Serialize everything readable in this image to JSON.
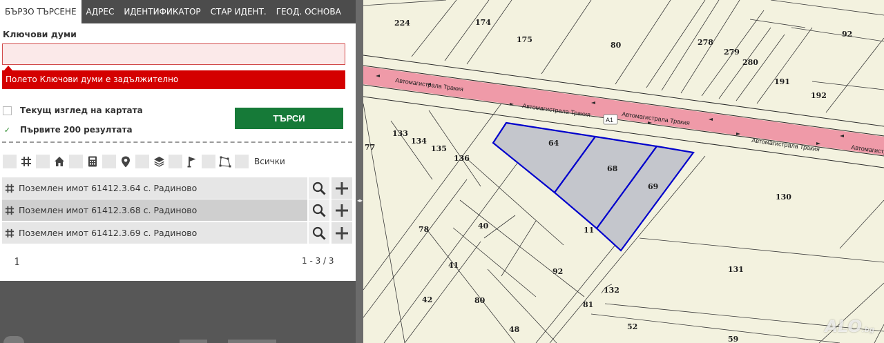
{
  "tabs": [
    {
      "label": "БЪРЗО ТЪРСЕНЕ",
      "active": true
    },
    {
      "label": "АДРЕС"
    },
    {
      "label": "ИДЕНТИФИКАТОР"
    },
    {
      "label": "СТАР ИДЕНТ."
    },
    {
      "label": "ГЕОД. ОСНОВА"
    }
  ],
  "search": {
    "keywords_label": "Ключови думи",
    "keywords_value": "",
    "error_message": "Полето Ключови думи е задължително",
    "current_view_label": "Текущ изглед на картата",
    "current_view_checked": false,
    "first_200_label": "Първите 200 резултата",
    "first_200_checked": true,
    "button_label": "ТЪРСИ"
  },
  "filters": {
    "icons": [
      "grid-icon",
      "home-icon",
      "calculator-icon",
      "location-pin-icon",
      "layers-icon",
      "flag-icon",
      "polygon-icon"
    ],
    "all_label": "Всички"
  },
  "results": [
    {
      "text": "Поземлен имот 61412.3.64 с. Радиново",
      "selected": false
    },
    {
      "text": "Поземлен имот 61412.3.68 с. Радиново",
      "selected": true
    },
    {
      "text": "Поземлен имот 61412.3.69 с. Радиново",
      "selected": false
    }
  ],
  "pagination": {
    "current_page": "1",
    "range": "1 - 3 / 3"
  },
  "splitter": {
    "handle": "◂▸"
  },
  "map": {
    "road_label": "Автомагистрала Тракия",
    "road_badge": "А1",
    "watermark": "ALO",
    "watermark_suffix": ".bg",
    "highlight_color": "#0000cc",
    "road_color": "#ef9aa8",
    "parcel_numbers": [
      "224",
      "174",
      "175",
      "80",
      "278",
      "279",
      "280",
      "92",
      "191",
      "192",
      "64",
      "68",
      "69",
      "133",
      "134",
      "135",
      "136",
      "77",
      "130",
      "78",
      "40",
      "41",
      "92",
      "42",
      "80",
      "81",
      "132",
      "131",
      "48",
      "52",
      "59",
      "11"
    ]
  }
}
